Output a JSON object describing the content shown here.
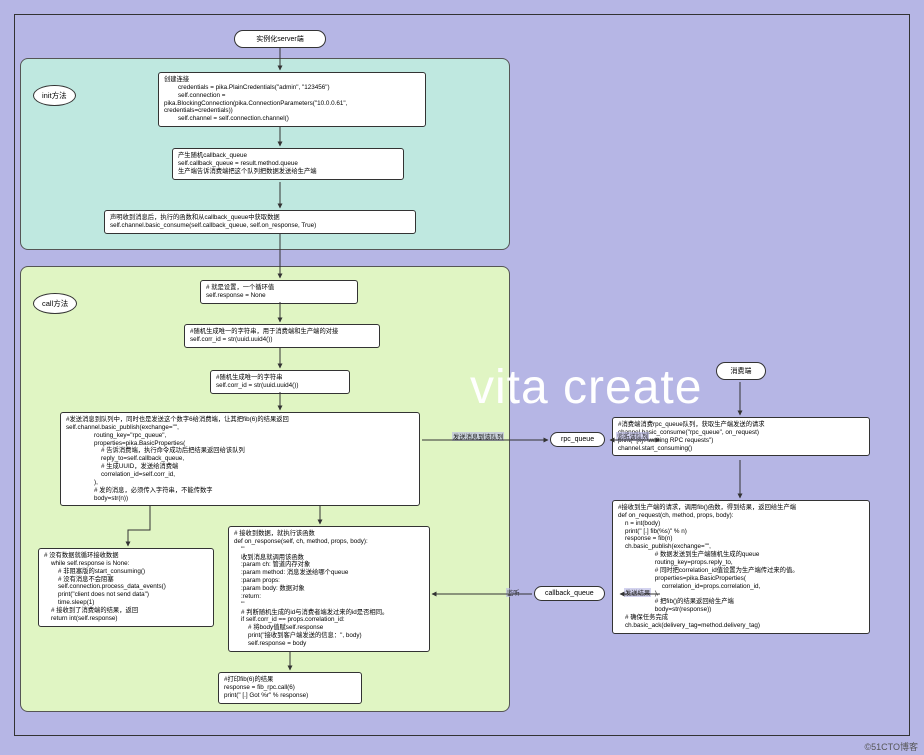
{
  "watermark": "vita create",
  "copyright": "©51CTO博客",
  "groups": {
    "init": {
      "label": "init方法"
    },
    "call": {
      "label": "call方法"
    }
  },
  "pills": {
    "server": "实例化server端",
    "rpc_queue": "rpc_queue",
    "callback_queue": "callback_queue",
    "consumer": "消费端"
  },
  "nodes": {
    "init1": "创建连接\n        credentials = pika.PlainCredentials(\"admin\", \"123456\")\n        self.connection =\npika.BlockingConnection(pika.ConnectionParameters(\"10.0.0.61\",\ncredentials=credentials))\n        self.channel = self.connection.channel()",
    "init2": "产生随机callback_queue\nself.callback_queue = result.method.queue\n生产端告诉消费端把这个队列把数据发送给生产端",
    "init3": "声明收到消息后，执行的函数和从callback_queue中获取数据\nself.channel.basic_consume(self.callback_queue, self.on_response, True)",
    "call1": "# 就是设置，一个循环值\nself.response = None",
    "call2": "#随机生成唯一的字符串，用于消费端和生产端的对接\nself.corr_id = str(uuid.uuid4())",
    "call3": "#随机生成唯一的字符串\nself.corr_id = str(uuid.uuid4())",
    "call4": "#发送消息到队列中，同时也是发送这个数字6给消费端，让其把fib(6)的结果返回\nself.channel.basic_publish(exchange=\"\",\n                routing_key=\"rpc_queue\",\n                properties=pika.BasicProperties(\n                    # 告诉消费端，执行命令成功后把结果返回给该队列\n                    reply_to=self.callback_queue,\n                    # 生成UUID，发送给消费端\n                    correlation_id=self.corr_id,\n                ),\n                # 发的消息，必须传入字符串，不能传数字\n                body=str(n))",
    "call5": "# 没有数据就循环接收数据\n    while self.response is None:\n        # 非阻塞版的start_consuming()\n        # 没有消息不会阻塞\n        self.connection.process_data_events()\n        print(\"client does not send data\")\n        time.sleep(1)\n    # 接收到了消费端的结果，返回\n    return int(self.response)",
    "call6": "# 接收到数据，就执行该函数\ndef on_response(self, ch, method, props, body):\n    '''\n    收到消息就调用该函数\n    :param ch: 管道内存对象\n    :param method: 消息发送给哪个queue\n    :param props:\n    :param body: 数据对象\n    :return:\n    '''\n    # 判断随机生成的id与消费者端发过来的id是否相同。\n    if self.corr_id == props.correlation_id:\n        # 将body值赋self.response\n        print(\"接收到客户端发送的信息：\", body)\n        self.response = body",
    "call7": "#打印fib(6)的结果\nresponse = fib_rpc.call(6)\nprint(\" [.] Got %r\" % response)",
    "cons1": "#消费端消费rpc_queue队列，获取生产端发送的请求\nchannel.basic_consume(\"rpc_queue\", on_request)\nprint(\" [x] Awaiting RPC requests\")\nchannel.start_consuming()",
    "cons2": "#接收到生产端的请求，调用fib()函数，得到结果，返回给生产端\ndef on_request(ch, method, props, body):\n    n = int(body)\n    print(\" [.] fib(%s)\" % n)\n    response = fib(n)\n    ch.basic_publish(exchange=\"\",\n                     # 数据发送到生产端随机生成的queue\n                     routing_key=props.reply_to,\n                     # 同时把correlation_id值设置为生产端传过来的值。\n                     properties=pika.BasicProperties(\n                         correlation_id=props.correlation_id,\n                     ),\n                     # 把fib()的结果返回给生产端\n                     body=str(response))\n    # 确保任务完成\n    ch.basic_ack(delivery_tag=method.delivery_tag)"
  },
  "edges": {
    "send_rpc": "发送消息到该队列",
    "recv_rpc": "监听该队列",
    "listen_cb": "监听",
    "send_cb": "发送结果"
  }
}
